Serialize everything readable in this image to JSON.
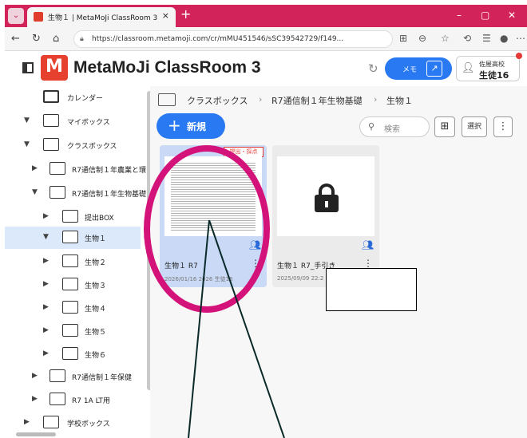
{
  "browser": {
    "tab_title": "生物１ | MetaMoJi ClassRoom 3",
    "tab_close": "×",
    "new_tab": "+",
    "url": "https://classroom.metamoji.com/cr/mMU451546/sSC39542729/f149..."
  },
  "app": {
    "logo_text": "MetaMoJi ClassRoom 3",
    "memo_label": "メモ",
    "user_school": "佐屋高校",
    "user_name": "生徒16"
  },
  "sidebar": {
    "items": [
      {
        "label": "カレンダー"
      },
      {
        "label": "マイボックス"
      },
      {
        "label": "クラスボックス"
      },
      {
        "label": "R7通信制１年農業と環"
      },
      {
        "label": "R7通信制１年生物基礎"
      },
      {
        "label": "提出BOX"
      },
      {
        "label": "生物１"
      },
      {
        "label": "生物２"
      },
      {
        "label": "生物３"
      },
      {
        "label": "生物４"
      },
      {
        "label": "生物５"
      },
      {
        "label": "生物６"
      },
      {
        "label": "R7通信制１年保健"
      },
      {
        "label": "R7 1A LT用"
      },
      {
        "label": "学校ボックス"
      }
    ]
  },
  "breadcrumb": {
    "items": [
      "クラスボックス",
      "R7通信制１年生物基礎",
      "生物１"
    ],
    "separator": "›"
  },
  "toolbar": {
    "new_label": "新規",
    "search_placeholder": "検索",
    "select_label": "選択"
  },
  "cards": [
    {
      "name": "生物１ R7",
      "date": "2026/01/16 2026 生徒16",
      "badge": "提出・採点"
    },
    {
      "name": "生物１ R7_手引き",
      "date": "2025/09/09 22:2"
    }
  ],
  "colors": {
    "browser_accent": "#d2235b",
    "primary_button": "#2979f2",
    "annotation": "#d4137a",
    "selected_card": "#c9d9f6"
  },
  "icons": [
    "panel-toggle-icon",
    "reload-icon",
    "external-link-icon",
    "person-icon",
    "calendar-icon",
    "folder-icon",
    "search-icon",
    "grid-view-icon",
    "kebab-icon",
    "lock-icon",
    "shared-users-icon"
  ]
}
